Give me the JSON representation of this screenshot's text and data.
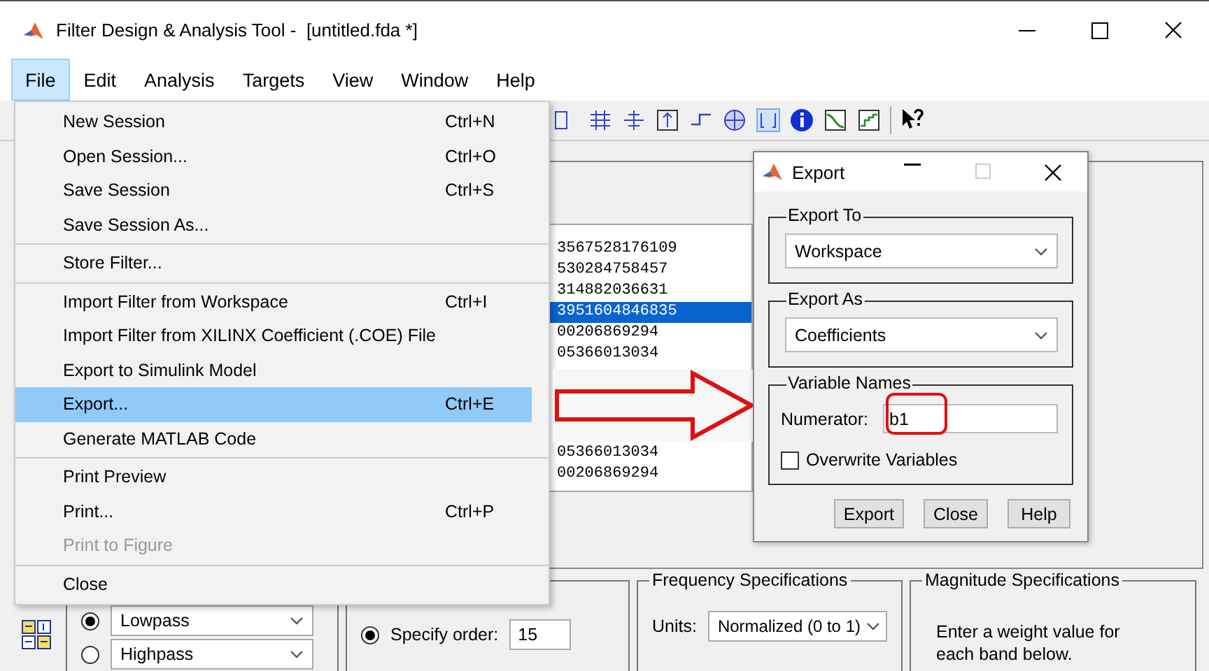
{
  "window": {
    "title": "Filter Design & Analysis Tool -  [untitled.fda *]"
  },
  "menu_bar": [
    {
      "label": "File",
      "selected": true
    },
    {
      "label": "Edit",
      "selected": false
    },
    {
      "label": "Analysis",
      "selected": false
    },
    {
      "label": "Targets",
      "selected": false
    },
    {
      "label": "View",
      "selected": false
    },
    {
      "label": "Window",
      "selected": false
    },
    {
      "label": "Help",
      "selected": false
    }
  ],
  "file_menu": {
    "groups": [
      [
        {
          "label": "New Session",
          "shortcut": "Ctrl+N",
          "selected": false,
          "disabled": false
        },
        {
          "label": "Open Session...",
          "shortcut": "Ctrl+O",
          "selected": false,
          "disabled": false
        },
        {
          "label": "Save Session",
          "shortcut": "Ctrl+S",
          "selected": false,
          "disabled": false
        },
        {
          "label": "Save Session As...",
          "selected": false,
          "disabled": false
        }
      ],
      [
        {
          "label": "Store Filter...",
          "selected": false,
          "disabled": false
        }
      ],
      [
        {
          "label": "Import Filter from Workspace",
          "shortcut": "Ctrl+I",
          "selected": false,
          "disabled": false
        },
        {
          "label": "Import Filter from XILINX Coefficient (.COE) File",
          "selected": false,
          "disabled": false
        },
        {
          "label": "Export to Simulink Model",
          "selected": false,
          "disabled": false
        },
        {
          "label": "Export...",
          "shortcut": "Ctrl+E",
          "selected": true,
          "disabled": false
        },
        {
          "label": "Generate MATLAB Code",
          "selected": false,
          "disabled": false
        }
      ],
      [
        {
          "label": "Print Preview",
          "selected": false,
          "disabled": false
        },
        {
          "label": "Print...",
          "shortcut": "Ctrl+P",
          "selected": false,
          "disabled": false
        },
        {
          "label": "Print to Figure",
          "selected": false,
          "disabled": true
        }
      ],
      [
        {
          "label": "Close",
          "selected": false,
          "disabled": false
        }
      ]
    ]
  },
  "coefficients": {
    "groups": [
      [
        {
          "text": "3567528176109",
          "selected": false
        },
        {
          "text": "530284758457",
          "selected": false
        },
        {
          "text": "314882036631",
          "selected": false
        },
        {
          "text": "3951604846835",
          "selected": true
        },
        {
          "text": "00206869294",
          "selected": false
        },
        {
          "text": "05366013034",
          "selected": false
        }
      ],
      [
        {
          "text": "05366013034",
          "selected": false
        },
        {
          "text": "00206869294",
          "selected": false
        }
      ]
    ]
  },
  "export_dialog": {
    "title": "Export",
    "export_to": {
      "label": "Export To",
      "value": "Workspace"
    },
    "export_as": {
      "label": "Export As",
      "value": "Coefficients"
    },
    "variable_names": {
      "label": "Variable Names",
      "numerator_label": "Numerator:",
      "numerator_value": "b1",
      "overwrite": {
        "label": "Overwrite Variables",
        "checked": false
      }
    },
    "buttons": [
      "Export",
      "Close",
      "Help"
    ]
  },
  "filter_type": {
    "options": [
      {
        "label": "Lowpass",
        "selected": true
      },
      {
        "label": "Highpass",
        "selected": false
      }
    ]
  },
  "filter_order": {
    "label": "Specify order:",
    "selected": true,
    "value": "15"
  },
  "frequency_specs": {
    "title": "Frequency Specifications",
    "units_label": "Units:",
    "units_value": "Normalized (0 to 1)"
  },
  "magnitude_specs": {
    "title": "Magnitude Specifications",
    "text": "Enter a weight value for each band below."
  }
}
